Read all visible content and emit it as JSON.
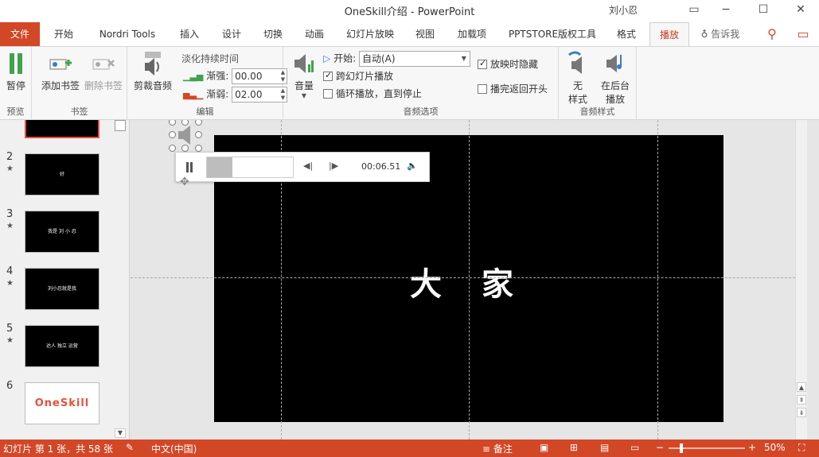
{
  "window": {
    "title": "OneSkill介绍  -  PowerPoint",
    "user_short": "刘小忍",
    "user_badge": "刘小忍",
    "minimize": "−",
    "restore": "☐",
    "close": "✕"
  },
  "tabs": [
    {
      "label": "文件"
    },
    {
      "label": "开始"
    },
    {
      "label": "Nordri Tools"
    },
    {
      "label": "插入"
    },
    {
      "label": "设计"
    },
    {
      "label": "切换"
    },
    {
      "label": "动画"
    },
    {
      "label": "幻灯片放映"
    },
    {
      "label": "视图"
    },
    {
      "label": "加载项"
    },
    {
      "label": "PPTSTORE版权工具"
    },
    {
      "label": "格式"
    },
    {
      "label": "播放"
    },
    {
      "label": "告诉我"
    }
  ],
  "ribbon": {
    "preview": {
      "label": "预览",
      "pause": "暂停"
    },
    "bookmarks": {
      "label": "书签",
      "add": "添加书签",
      "remove": "删除书签"
    },
    "edit": {
      "label": "编辑",
      "trim": "剪裁音频",
      "fade_title": "淡化持续时间",
      "fade_in_label": "渐强:",
      "fade_in_value": "00.00",
      "fade_out_label": "渐弱:",
      "fade_out_value": "02.00"
    },
    "audio_options": {
      "label": "音频选项",
      "volume": "音量",
      "start_label": "开始:",
      "start_value": "自动(A)",
      "play_across": "跨幻灯片播放",
      "loop": "循环播放，直到停止",
      "hide": "放映时隐藏",
      "rewind": "播完返回开头"
    },
    "audio_styles": {
      "label": "音频样式",
      "none": "无\n样式",
      "none_l1": "无",
      "none_l2": "样式",
      "bg_l1": "在后台",
      "bg_l2": "播放"
    }
  },
  "thumbnails": [
    {
      "num": "2",
      "text": "好"
    },
    {
      "num": "3",
      "text": "我是 刘 小 忍"
    },
    {
      "num": "4",
      "text": "刘小忍就是我"
    },
    {
      "num": "5",
      "text": "达人 独立 运营"
    },
    {
      "num": "6",
      "text": "OneSkill"
    }
  ],
  "slide": {
    "text": "大 家"
  },
  "player": {
    "time": "00:06.51",
    "progress": 0.3
  },
  "status": {
    "slide_info": "幻灯片 第 1 张，共 58 张",
    "language": "中文(中国)",
    "notes": "备注",
    "zoom": "50%",
    "minus": "−",
    "plus": "+"
  },
  "colors": {
    "accent": "#d24726",
    "slide_bg": "#000000"
  }
}
